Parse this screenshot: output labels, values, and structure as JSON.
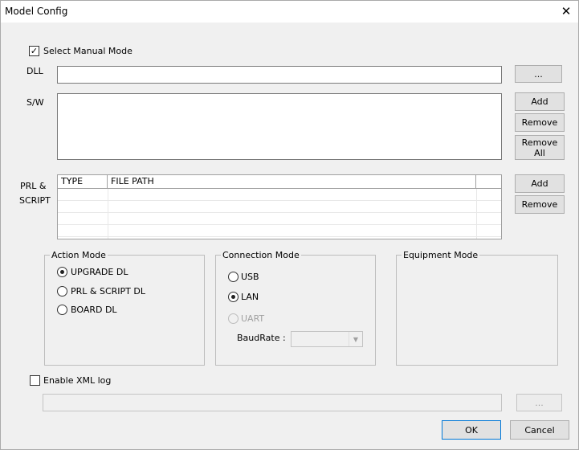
{
  "window": {
    "title": "Model Config"
  },
  "manual_mode": {
    "label": "Select Manual Mode",
    "checked": true
  },
  "dll": {
    "label": "DLL",
    "value": "",
    "browse_label": "..."
  },
  "sw": {
    "label": "S/W",
    "add_label": "Add",
    "remove_label": "Remove",
    "remove_all_label": "Remove All"
  },
  "prl": {
    "label_line1": "PRL  &",
    "label_line2": "SCRIPT",
    "columns": [
      "TYPE",
      "FILE PATH"
    ],
    "add_label": "Add",
    "remove_label": "Remove"
  },
  "action_mode": {
    "title": "Action Mode",
    "options": [
      {
        "label": "UPGRADE DL",
        "checked": true
      },
      {
        "label": "PRL & SCRIPT DL",
        "checked": false
      },
      {
        "label": "BOARD DL",
        "checked": false
      }
    ]
  },
  "connection_mode": {
    "title": "Connection Mode",
    "options": [
      {
        "label": "USB",
        "checked": false
      },
      {
        "label": "LAN",
        "checked": true
      },
      {
        "label": "UART",
        "checked": false,
        "disabled": true
      }
    ],
    "baudrate_label": "BaudRate :",
    "baudrate_value": ""
  },
  "equipment_mode": {
    "title": "Equipment Mode"
  },
  "xml_log": {
    "label": "Enable XML log",
    "checked": false,
    "path": "",
    "browse_label": "..."
  },
  "footer": {
    "ok_label": "OK",
    "cancel_label": "Cancel"
  }
}
